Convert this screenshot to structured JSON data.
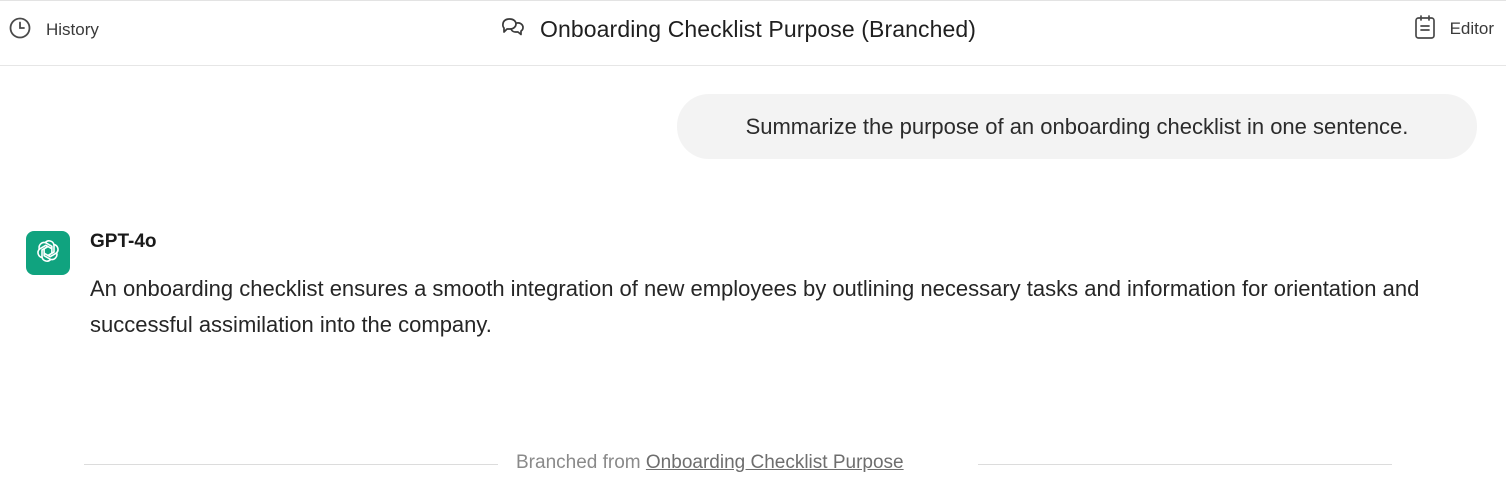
{
  "header": {
    "history_label": "History",
    "title": "Onboarding Checklist Purpose (Branched)",
    "editor_label": "Editor"
  },
  "conversation": {
    "user_message": "Summarize the purpose of an onboarding checklist in one sentence.",
    "assistant": {
      "model_name": "GPT-4o",
      "message": "An onboarding checklist ensures a smooth integration of new employees by outlining necessary tasks and information for orientation and successful assimilation into the company."
    }
  },
  "footer": {
    "branched_prefix": "Branched from",
    "branched_link": "Onboarding Checklist Purpose"
  },
  "icons": {
    "history": "clock-icon",
    "title": "chat-bubbles-icon",
    "editor": "notepad-icon",
    "avatar": "openai-logo-icon"
  },
  "colors": {
    "avatar_bg": "#10a37f",
    "bubble_bg": "#f3f3f3"
  }
}
